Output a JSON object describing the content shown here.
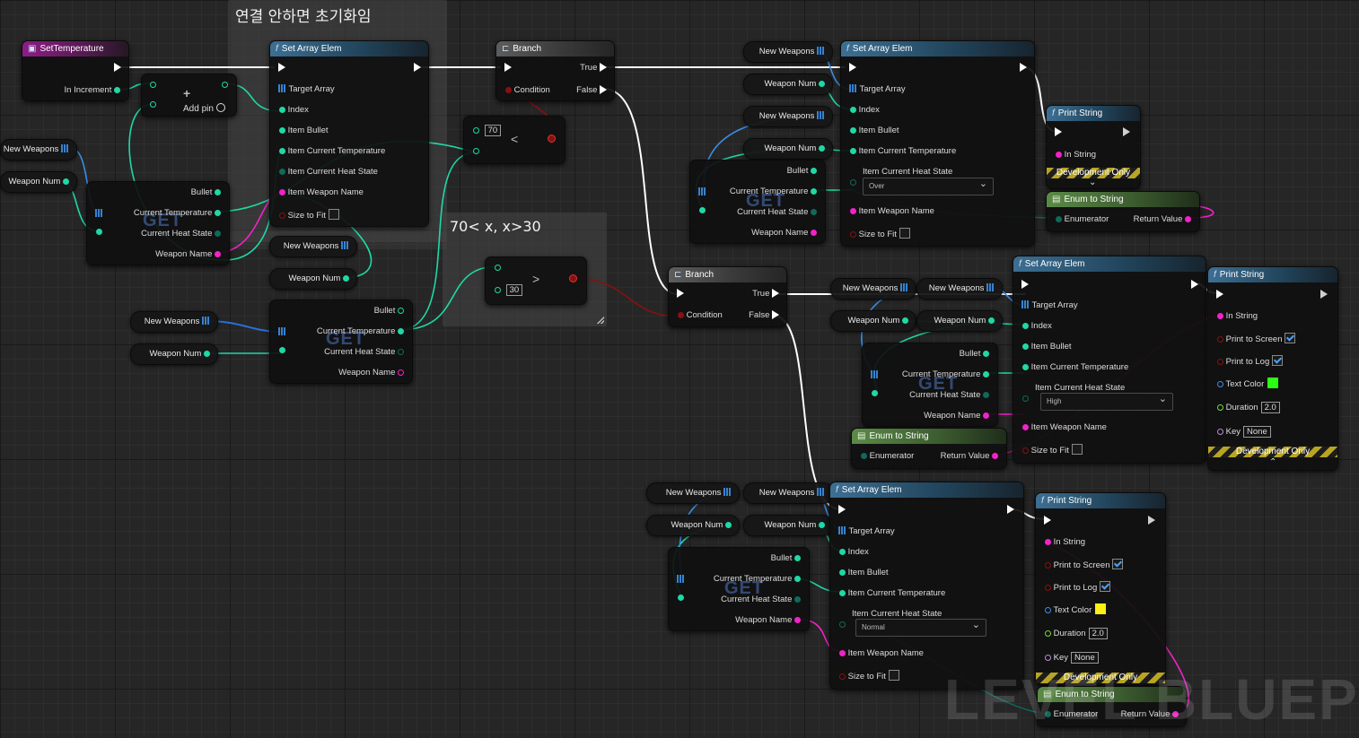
{
  "comments": {
    "reset": "연결 안하면 초기화임",
    "range": "70< x, x>30"
  },
  "event": {
    "title": "SetTemperature",
    "in_increment": "In Increment",
    "add_pin": "Add pin"
  },
  "set_array_elem": {
    "title": "Set Array Elem",
    "target_array": "Target Array",
    "index": "Index",
    "item_bullet": "Item Bullet",
    "item_current_temperature": "Item Current Temperature",
    "item_current_heat_state": "Item Current Heat State",
    "item_weapon_name": "Item Weapon Name",
    "size_to_fit": "Size to Fit"
  },
  "heat_states": {
    "over": "Over",
    "high": "High",
    "normal": "Normal"
  },
  "branch": {
    "title": "Branch",
    "true": "True",
    "false": "False",
    "condition": "Condition"
  },
  "compare": {
    "less_value": "70",
    "less_op": "<",
    "greater_value": "30",
    "greater_op": ">"
  },
  "vars": {
    "new_weapons": "New Weapons",
    "weapon_num": "Weapon Num"
  },
  "get": {
    "watermark": "GET",
    "bullet": "Bullet",
    "current_temperature": "Current Temperature",
    "current_heat_state": "Current Heat State",
    "weapon_name": "Weapon Name"
  },
  "print_string": {
    "title": "Print String",
    "in_string": "In String",
    "print_to_screen": "Print to Screen",
    "print_to_log": "Print to Log",
    "text_color": "Text Color",
    "duration": "Duration",
    "duration_value": "2.0",
    "key": "Key",
    "key_value": "None",
    "dev_only": "Development Only"
  },
  "enum_to_string": {
    "title": "Enum to String",
    "enumerator": "Enumerator",
    "return_value": "Return Value"
  },
  "colors": {
    "exec": "#ffffff",
    "int": "#1ed9a6",
    "struct_array": "#3a8ee6",
    "string": "#f222c8",
    "bool": "#8a1010",
    "enum": "#0f6a5d",
    "print_green": "#2bff12",
    "print_yellow": "#ffee11"
  },
  "watermark": "LEVEL BLUEPRINT"
}
